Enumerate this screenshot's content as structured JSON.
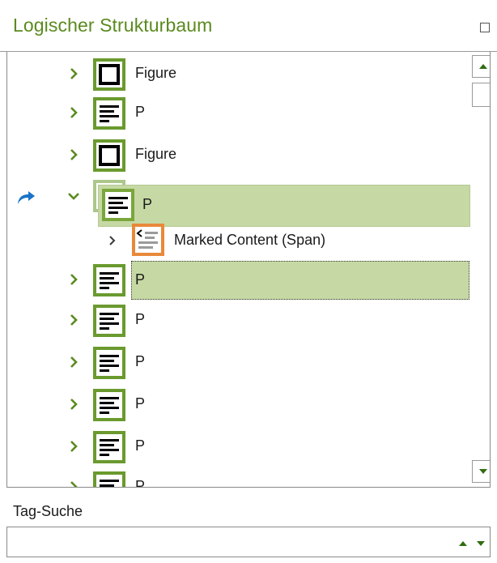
{
  "panel": {
    "title": "Logischer Strukturbaum",
    "maximize_icon": "maximize-icon"
  },
  "tree": {
    "rows": [
      {
        "label": "Figure",
        "icon": "figure-tag-icon",
        "expanded": false
      },
      {
        "label": "P",
        "icon": "paragraph-tag-icon",
        "expanded": false
      },
      {
        "label": "Figure",
        "icon": "figure-tag-icon",
        "expanded": false
      },
      {
        "label": "P",
        "icon": "paragraph-tag-icon",
        "expanded": true,
        "drag_source": true,
        "drag_label": "P"
      },
      {
        "label": "Marked Content (Span)",
        "icon": "marked-content-icon",
        "expanded": false,
        "child": true
      },
      {
        "label": "P",
        "icon": "paragraph-tag-icon",
        "expanded": false,
        "drop_target": true
      },
      {
        "label": "P",
        "icon": "paragraph-tag-icon",
        "expanded": false
      },
      {
        "label": "P",
        "icon": "paragraph-tag-icon",
        "expanded": false
      },
      {
        "label": "P",
        "icon": "paragraph-tag-icon",
        "expanded": false
      },
      {
        "label": "P",
        "icon": "paragraph-tag-icon",
        "expanded": false
      },
      {
        "label": "P",
        "icon": "paragraph-tag-icon",
        "expanded": false
      }
    ],
    "scrollbar": {
      "up_icon": "scroll-up-icon",
      "down_icon": "scroll-down-icon"
    }
  },
  "search": {
    "label": "Tag-Suche",
    "value": "",
    "placeholder": ""
  },
  "colors": {
    "title": "#5b8a1f",
    "tag_border": "#6a9a2e",
    "marked_content_border": "#e8893a",
    "highlight": "#c6d9a4",
    "chevron": "#5b8a1f",
    "move_arrow": "#1a73c8"
  }
}
